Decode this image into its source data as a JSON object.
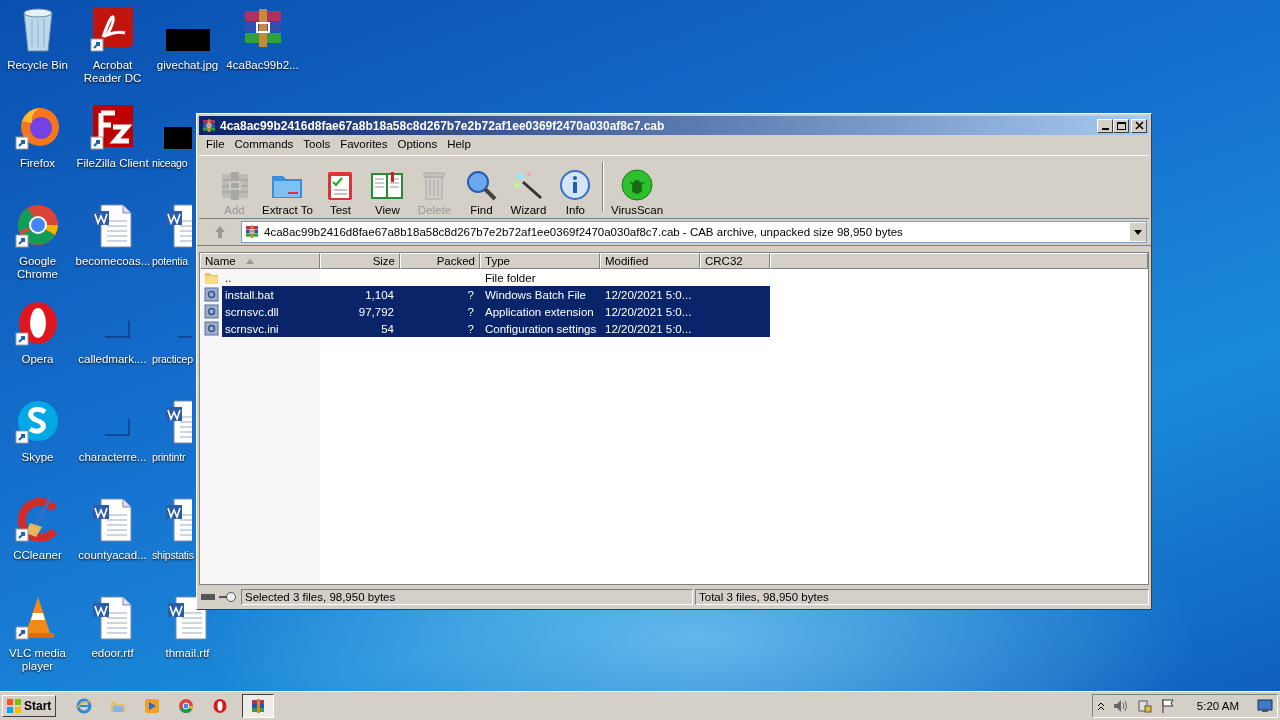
{
  "desktop": {
    "icons": [
      {
        "label": "Recycle Bin",
        "kind": "recycle",
        "shortcut": false
      },
      {
        "label": "Firefox",
        "kind": "firefox",
        "shortcut": true
      },
      {
        "label": "Google Chrome",
        "kind": "chrome",
        "shortcut": true
      },
      {
        "label": "Opera",
        "kind": "opera",
        "shortcut": true
      },
      {
        "label": "Skype",
        "kind": "skype",
        "shortcut": true
      },
      {
        "label": "CCleaner",
        "kind": "ccleaner",
        "shortcut": true
      },
      {
        "label": "VLC media player",
        "kind": "vlc",
        "shortcut": true
      },
      {
        "label": "Acrobat Reader DC",
        "kind": "pdf",
        "shortcut": true
      },
      {
        "label": "FileZilla Client",
        "kind": "filezilla",
        "shortcut": true
      },
      {
        "label": "becomecoas...",
        "kind": "word",
        "shortcut": false
      },
      {
        "label": "calledmark....",
        "kind": "faint",
        "shortcut": false
      },
      {
        "label": "characterre...",
        "kind": "faint",
        "shortcut": false
      },
      {
        "label": "countyacad...",
        "kind": "word",
        "shortcut": false
      },
      {
        "label": "edoor.rtf",
        "kind": "word",
        "shortcut": false
      },
      {
        "label": "givechat.jpg",
        "kind": "black",
        "shortcut": false
      },
      {
        "label": "niceago",
        "kind": "black",
        "shortcut": false
      },
      {
        "label": "potentia",
        "kind": "word",
        "shortcut": false
      },
      {
        "label": "practicep",
        "kind": "faint",
        "shortcut": false
      },
      {
        "label": "printintr",
        "kind": "word",
        "shortcut": false
      },
      {
        "label": "shipstatis",
        "kind": "word",
        "shortcut": false
      },
      {
        "label": "thmail.rtf",
        "kind": "word",
        "shortcut": false
      },
      {
        "label": "4ca8ac99b2...",
        "kind": "archive",
        "shortcut": false
      }
    ]
  },
  "window": {
    "title": "4ca8ac99b2416d8fae67a8b18a58c8d267b7e2b72af1ee0369f2470a030af8c7.cab",
    "menu": [
      "File",
      "Commands",
      "Tools",
      "Favorites",
      "Options",
      "Help"
    ],
    "toolbar": [
      {
        "label": "Add",
        "kind": "add",
        "disabled": true
      },
      {
        "label": "Extract To",
        "kind": "extract",
        "disabled": false
      },
      {
        "label": "Test",
        "kind": "test",
        "disabled": false
      },
      {
        "label": "View",
        "kind": "view",
        "disabled": false
      },
      {
        "label": "Delete",
        "kind": "delete",
        "disabled": true
      },
      {
        "label": "Find",
        "kind": "find",
        "disabled": false
      },
      {
        "label": "Wizard",
        "kind": "wizard",
        "disabled": false
      },
      {
        "label": "Info",
        "kind": "info",
        "disabled": false
      },
      {
        "label": "VirusScan",
        "kind": "virus",
        "disabled": false
      }
    ],
    "address": "4ca8ac99b2416d8fae67a8b18a58c8d267b7e2b72af1ee0369f2470a030af8c7.cab - CAB archive, unpacked size 98,950 bytes",
    "table": {
      "columns": [
        {
          "label": "Name",
          "sorted": true
        },
        {
          "label": "Size",
          "sorted": false
        },
        {
          "label": "Packed",
          "sorted": false
        },
        {
          "label": "Type",
          "sorted": false
        },
        {
          "label": "Modified",
          "sorted": false
        },
        {
          "label": "CRC32",
          "sorted": false
        }
      ],
      "rows": [
        {
          "kind": "folder",
          "name": "..",
          "size": "",
          "packed": "",
          "type": "File folder",
          "modified": "",
          "selected": false
        },
        {
          "kind": "file",
          "name": "install.bat",
          "size": "1,104",
          "packed": "?",
          "type": "Windows Batch File",
          "modified": "12/20/2021 5:0...",
          "selected": true
        },
        {
          "kind": "file",
          "name": "scrnsvc.dll",
          "size": "97,792",
          "packed": "?",
          "type": "Application extension",
          "modified": "12/20/2021 5:0...",
          "selected": true
        },
        {
          "kind": "file",
          "name": "scrnsvc.ini",
          "size": "54",
          "packed": "?",
          "type": "Configuration settings",
          "modified": "12/20/2021 5:0...",
          "selected": true
        }
      ]
    },
    "status_bar": {
      "left": "Selected 3 files, 98,950 bytes",
      "right": "Total 3 files, 98,950 bytes"
    }
  },
  "taskbar": {
    "start": "Start",
    "apps": [
      {
        "kind": "ie",
        "active": false
      },
      {
        "kind": "explorer",
        "active": false
      },
      {
        "kind": "media",
        "active": false
      },
      {
        "kind": "chrome",
        "active": false
      },
      {
        "kind": "opera",
        "active": false
      },
      {
        "kind": "archive",
        "active": true
      }
    ],
    "clock": "5:20 AM"
  }
}
